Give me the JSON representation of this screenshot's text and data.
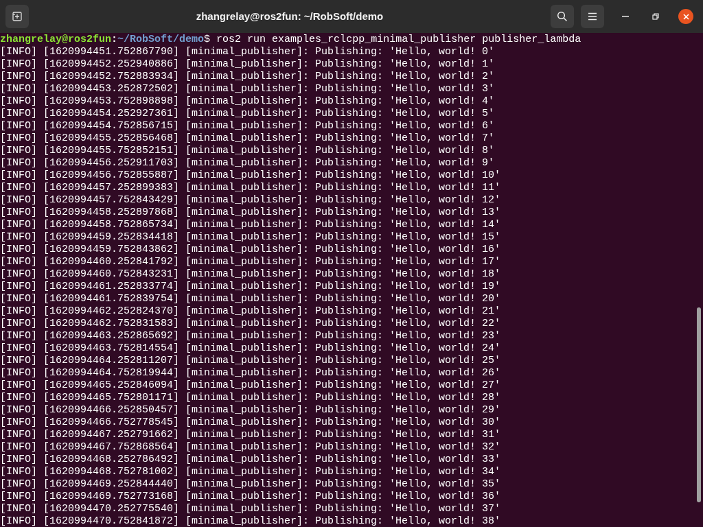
{
  "window": {
    "title": "zhangrelay@ros2fun: ~/RobSoft/demo"
  },
  "prompt": {
    "user_host": "zhangrelay@ros2fun",
    "separator": ":",
    "path": "~/RobSoft/demo",
    "symbol": "$",
    "command": " ros2 run examples_rclcpp_minimal_publisher publisher_lambda"
  },
  "output": [
    "[INFO] [1620994451.752867790] [minimal_publisher]: Publishing: 'Hello, world! 0'",
    "[INFO] [1620994452.252940886] [minimal_publisher]: Publishing: 'Hello, world! 1'",
    "[INFO] [1620994452.752883934] [minimal_publisher]: Publishing: 'Hello, world! 2'",
    "[INFO] [1620994453.252872502] [minimal_publisher]: Publishing: 'Hello, world! 3'",
    "[INFO] [1620994453.752898898] [minimal_publisher]: Publishing: 'Hello, world! 4'",
    "[INFO] [1620994454.252927361] [minimal_publisher]: Publishing: 'Hello, world! 5'",
    "[INFO] [1620994454.752856715] [minimal_publisher]: Publishing: 'Hello, world! 6'",
    "[INFO] [1620994455.252856468] [minimal_publisher]: Publishing: 'Hello, world! 7'",
    "[INFO] [1620994455.752852151] [minimal_publisher]: Publishing: 'Hello, world! 8'",
    "[INFO] [1620994456.252911703] [minimal_publisher]: Publishing: 'Hello, world! 9'",
    "[INFO] [1620994456.752855887] [minimal_publisher]: Publishing: 'Hello, world! 10'",
    "[INFO] [1620994457.252899383] [minimal_publisher]: Publishing: 'Hello, world! 11'",
    "[INFO] [1620994457.752843429] [minimal_publisher]: Publishing: 'Hello, world! 12'",
    "[INFO] [1620994458.252897868] [minimal_publisher]: Publishing: 'Hello, world! 13'",
    "[INFO] [1620994458.752865734] [minimal_publisher]: Publishing: 'Hello, world! 14'",
    "[INFO] [1620994459.252834418] [minimal_publisher]: Publishing: 'Hello, world! 15'",
    "[INFO] [1620994459.752843862] [minimal_publisher]: Publishing: 'Hello, world! 16'",
    "[INFO] [1620994460.252841792] [minimal_publisher]: Publishing: 'Hello, world! 17'",
    "[INFO] [1620994460.752843231] [minimal_publisher]: Publishing: 'Hello, world! 18'",
    "[INFO] [1620994461.252833774] [minimal_publisher]: Publishing: 'Hello, world! 19'",
    "[INFO] [1620994461.752839754] [minimal_publisher]: Publishing: 'Hello, world! 20'",
    "[INFO] [1620994462.252824370] [minimal_publisher]: Publishing: 'Hello, world! 21'",
    "[INFO] [1620994462.752831583] [minimal_publisher]: Publishing: 'Hello, world! 22'",
    "[INFO] [1620994463.252865692] [minimal_publisher]: Publishing: 'Hello, world! 23'",
    "[INFO] [1620994463.752814554] [minimal_publisher]: Publishing: 'Hello, world! 24'",
    "[INFO] [1620994464.252811207] [minimal_publisher]: Publishing: 'Hello, world! 25'",
    "[INFO] [1620994464.752819944] [minimal_publisher]: Publishing: 'Hello, world! 26'",
    "[INFO] [1620994465.252846094] [minimal_publisher]: Publishing: 'Hello, world! 27'",
    "[INFO] [1620994465.752801171] [minimal_publisher]: Publishing: 'Hello, world! 28'",
    "[INFO] [1620994466.252850457] [minimal_publisher]: Publishing: 'Hello, world! 29'",
    "[INFO] [1620994466.752778545] [minimal_publisher]: Publishing: 'Hello, world! 30'",
    "[INFO] [1620994467.252791662] [minimal_publisher]: Publishing: 'Hello, world! 31'",
    "[INFO] [1620994467.752868564] [minimal_publisher]: Publishing: 'Hello, world! 32'",
    "[INFO] [1620994468.252786492] [minimal_publisher]: Publishing: 'Hello, world! 33'",
    "[INFO] [1620994468.752781002] [minimal_publisher]: Publishing: 'Hello, world! 34'",
    "[INFO] [1620994469.252844440] [minimal_publisher]: Publishing: 'Hello, world! 35'",
    "[INFO] [1620994469.752773168] [minimal_publisher]: Publishing: 'Hello, world! 36'",
    "[INFO] [1620994470.252775540] [minimal_publisher]: Publishing: 'Hello, world! 37'",
    "[INFO] [1620994470.752841872] [minimal_publisher]: Publishing: 'Hello, world! 38'"
  ]
}
